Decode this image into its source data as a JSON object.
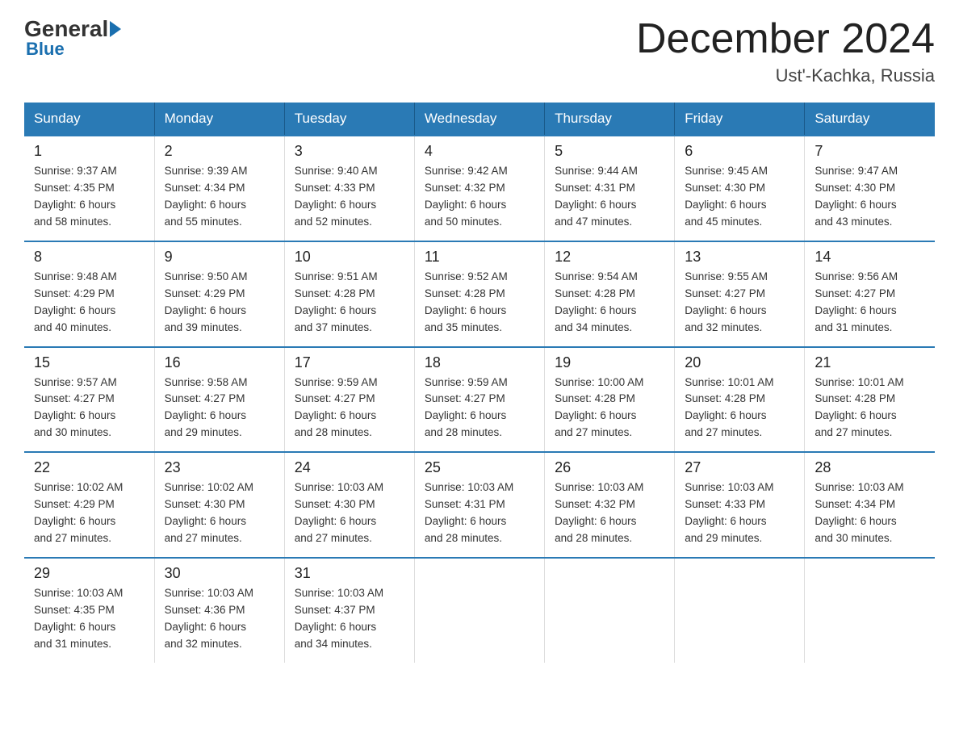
{
  "header": {
    "logo_general": "General",
    "logo_blue": "Blue",
    "month_title": "December 2024",
    "location": "Ust'-Kachka, Russia"
  },
  "weekdays": [
    "Sunday",
    "Monday",
    "Tuesday",
    "Wednesday",
    "Thursday",
    "Friday",
    "Saturday"
  ],
  "weeks": [
    [
      {
        "day": "1",
        "sunrise": "9:37 AM",
        "sunset": "4:35 PM",
        "daylight_hours": "6",
        "daylight_minutes": "58"
      },
      {
        "day": "2",
        "sunrise": "9:39 AM",
        "sunset": "4:34 PM",
        "daylight_hours": "6",
        "daylight_minutes": "55"
      },
      {
        "day": "3",
        "sunrise": "9:40 AM",
        "sunset": "4:33 PM",
        "daylight_hours": "6",
        "daylight_minutes": "52"
      },
      {
        "day": "4",
        "sunrise": "9:42 AM",
        "sunset": "4:32 PM",
        "daylight_hours": "6",
        "daylight_minutes": "50"
      },
      {
        "day": "5",
        "sunrise": "9:44 AM",
        "sunset": "4:31 PM",
        "daylight_hours": "6",
        "daylight_minutes": "47"
      },
      {
        "day": "6",
        "sunrise": "9:45 AM",
        "sunset": "4:30 PM",
        "daylight_hours": "6",
        "daylight_minutes": "45"
      },
      {
        "day": "7",
        "sunrise": "9:47 AM",
        "sunset": "4:30 PM",
        "daylight_hours": "6",
        "daylight_minutes": "43"
      }
    ],
    [
      {
        "day": "8",
        "sunrise": "9:48 AM",
        "sunset": "4:29 PM",
        "daylight_hours": "6",
        "daylight_minutes": "40"
      },
      {
        "day": "9",
        "sunrise": "9:50 AM",
        "sunset": "4:29 PM",
        "daylight_hours": "6",
        "daylight_minutes": "39"
      },
      {
        "day": "10",
        "sunrise": "9:51 AM",
        "sunset": "4:28 PM",
        "daylight_hours": "6",
        "daylight_minutes": "37"
      },
      {
        "day": "11",
        "sunrise": "9:52 AM",
        "sunset": "4:28 PM",
        "daylight_hours": "6",
        "daylight_minutes": "35"
      },
      {
        "day": "12",
        "sunrise": "9:54 AM",
        "sunset": "4:28 PM",
        "daylight_hours": "6",
        "daylight_minutes": "34"
      },
      {
        "day": "13",
        "sunrise": "9:55 AM",
        "sunset": "4:27 PM",
        "daylight_hours": "6",
        "daylight_minutes": "32"
      },
      {
        "day": "14",
        "sunrise": "9:56 AM",
        "sunset": "4:27 PM",
        "daylight_hours": "6",
        "daylight_minutes": "31"
      }
    ],
    [
      {
        "day": "15",
        "sunrise": "9:57 AM",
        "sunset": "4:27 PM",
        "daylight_hours": "6",
        "daylight_minutes": "30"
      },
      {
        "day": "16",
        "sunrise": "9:58 AM",
        "sunset": "4:27 PM",
        "daylight_hours": "6",
        "daylight_minutes": "29"
      },
      {
        "day": "17",
        "sunrise": "9:59 AM",
        "sunset": "4:27 PM",
        "daylight_hours": "6",
        "daylight_minutes": "28"
      },
      {
        "day": "18",
        "sunrise": "9:59 AM",
        "sunset": "4:27 PM",
        "daylight_hours": "6",
        "daylight_minutes": "28"
      },
      {
        "day": "19",
        "sunrise": "10:00 AM",
        "sunset": "4:28 PM",
        "daylight_hours": "6",
        "daylight_minutes": "27"
      },
      {
        "day": "20",
        "sunrise": "10:01 AM",
        "sunset": "4:28 PM",
        "daylight_hours": "6",
        "daylight_minutes": "27"
      },
      {
        "day": "21",
        "sunrise": "10:01 AM",
        "sunset": "4:28 PM",
        "daylight_hours": "6",
        "daylight_minutes": "27"
      }
    ],
    [
      {
        "day": "22",
        "sunrise": "10:02 AM",
        "sunset": "4:29 PM",
        "daylight_hours": "6",
        "daylight_minutes": "27"
      },
      {
        "day": "23",
        "sunrise": "10:02 AM",
        "sunset": "4:30 PM",
        "daylight_hours": "6",
        "daylight_minutes": "27"
      },
      {
        "day": "24",
        "sunrise": "10:03 AM",
        "sunset": "4:30 PM",
        "daylight_hours": "6",
        "daylight_minutes": "27"
      },
      {
        "day": "25",
        "sunrise": "10:03 AM",
        "sunset": "4:31 PM",
        "daylight_hours": "6",
        "daylight_minutes": "28"
      },
      {
        "day": "26",
        "sunrise": "10:03 AM",
        "sunset": "4:32 PM",
        "daylight_hours": "6",
        "daylight_minutes": "28"
      },
      {
        "day": "27",
        "sunrise": "10:03 AM",
        "sunset": "4:33 PM",
        "daylight_hours": "6",
        "daylight_minutes": "29"
      },
      {
        "day": "28",
        "sunrise": "10:03 AM",
        "sunset": "4:34 PM",
        "daylight_hours": "6",
        "daylight_minutes": "30"
      }
    ],
    [
      {
        "day": "29",
        "sunrise": "10:03 AM",
        "sunset": "4:35 PM",
        "daylight_hours": "6",
        "daylight_minutes": "31"
      },
      {
        "day": "30",
        "sunrise": "10:03 AM",
        "sunset": "4:36 PM",
        "daylight_hours": "6",
        "daylight_minutes": "32"
      },
      {
        "day": "31",
        "sunrise": "10:03 AM",
        "sunset": "4:37 PM",
        "daylight_hours": "6",
        "daylight_minutes": "34"
      },
      null,
      null,
      null,
      null
    ]
  ]
}
